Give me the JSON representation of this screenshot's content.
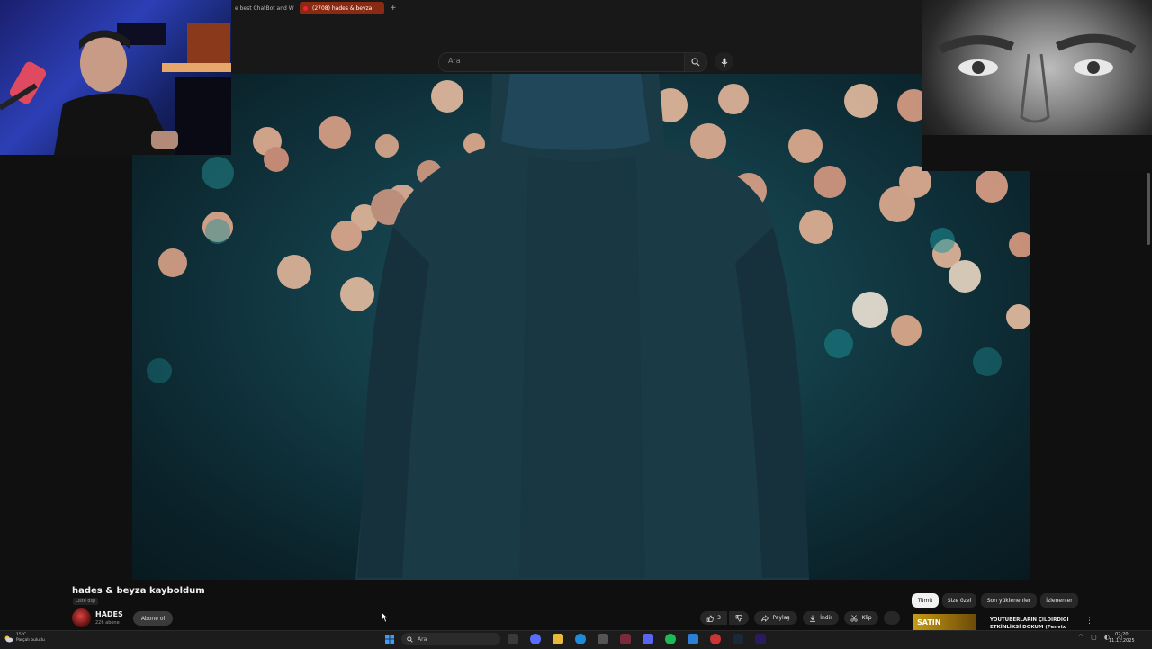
{
  "browser": {
    "tabs": [
      {
        "label": "e best ChatBot and W"
      },
      {
        "label": "(2708) hades & beyza"
      }
    ],
    "new_tab_icon": "plus"
  },
  "search": {
    "placeholder": "Ara"
  },
  "video": {
    "title": "hades & beyza kayboldum",
    "list_badge": "Liste dışı"
  },
  "channel": {
    "name": "HADES",
    "subscribers": "226 abone",
    "subscribe_label": "Abone ol"
  },
  "actions": {
    "likes": "3",
    "share": "Paylaş",
    "download": "İndir",
    "clip": "Klip"
  },
  "filter_chips": [
    "Tümü",
    "Size özel",
    "Son yüklenenler",
    "İzlenenler"
  ],
  "ad": {
    "brand": "SATIN",
    "text": "YOUTUBERLARIN ÇILDIRDIĞI ETKİNLİKSİ DOKUM (Fenvix"
  },
  "taskbar": {
    "weather_temp": "15°C",
    "weather_desc": "Parçalı bulutlu",
    "search_label": "Ara",
    "time": "02:20",
    "date": "11.11.2025"
  },
  "colors": {
    "active_tab": "#8a2a12",
    "teal_bg": "#123a44",
    "accent": "#ff0000"
  }
}
